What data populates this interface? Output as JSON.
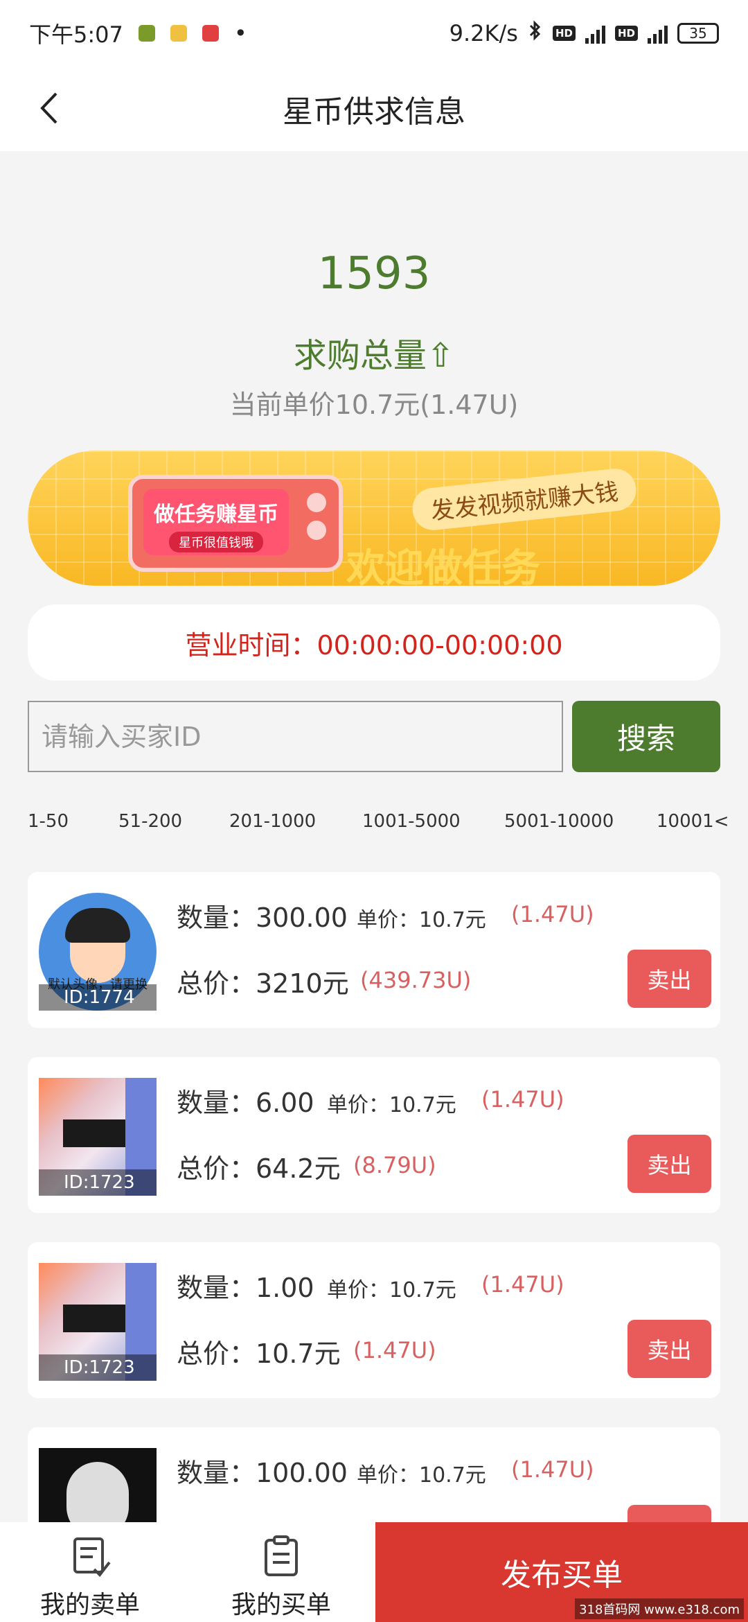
{
  "status_bar": {
    "time": "下午5:07",
    "speed": "9.2K/s",
    "signal1": "4G",
    "signal2": "4G",
    "hd": "HD",
    "battery": "35"
  },
  "nav": {
    "title": "星币供求信息"
  },
  "summary": {
    "total": "1593",
    "total_label": "求购总量⇧",
    "price_line": "当前单价10.7元(1.47U)"
  },
  "banner": {
    "tv_title": "做任务赚星币",
    "tv_subtitle": "星币很值钱哦",
    "slogan": "发发视频就赚大钱",
    "welcome": "欢迎做任务"
  },
  "hours": {
    "text": "营业时间：00:00:00-00:00:00"
  },
  "search": {
    "placeholder": "请输入买家ID",
    "button": "搜索"
  },
  "ranges": [
    "1-50",
    "51-200",
    "201-1000",
    "1001-5000",
    "5001-10000",
    "10001<"
  ],
  "listings": [
    {
      "id": "ID:1774",
      "avatar_note": "默认头像，请更换",
      "qty": "数量：300.00",
      "unit": "单价：10.7元",
      "unit_usd": "(1.47U)",
      "total": "总价：3210元",
      "total_usd": "(439.73U)",
      "sell": "卖出"
    },
    {
      "id": "ID:1723",
      "qty": "数量：6.00",
      "unit": "单价：10.7元",
      "unit_usd": "(1.47U)",
      "total": "总价：64.2元",
      "total_usd": "(8.79U)",
      "sell": "卖出"
    },
    {
      "id": "ID:1723",
      "qty": "数量：1.00",
      "unit": "单价：10.7元",
      "unit_usd": "(1.47U)",
      "total": "总价：10.7元",
      "total_usd": "(1.47U)",
      "sell": "卖出"
    },
    {
      "qty": "数量：100.00",
      "unit": "单价：10.7元",
      "unit_usd": "(1.47U)"
    }
  ],
  "bottom": {
    "my_sell": "我的卖单",
    "my_buy": "我的买单",
    "publish": "发布买单"
  },
  "watermark": "318首码网 www.e318.com",
  "colors": {
    "accent_green": "#4d7c2f",
    "sell_red": "#e85b5a",
    "publish_red": "#d8382f",
    "hours_red": "#d3241c"
  }
}
